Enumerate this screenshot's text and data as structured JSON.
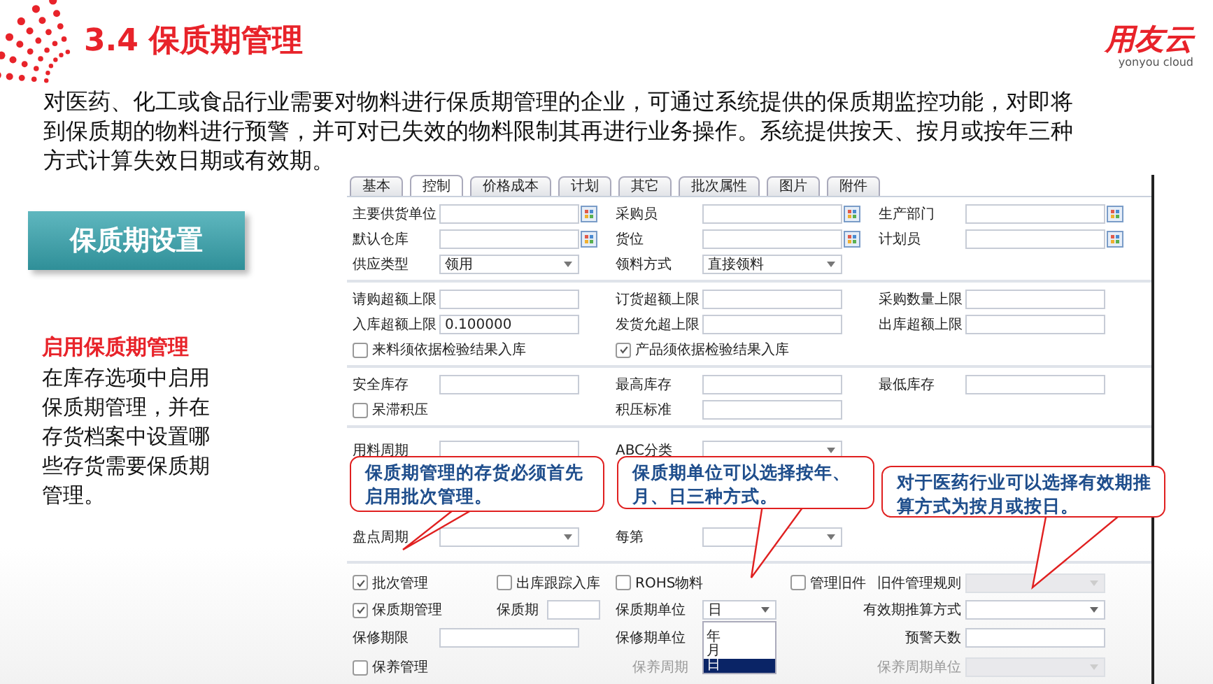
{
  "slide": {
    "title": "3.4 保质期管理",
    "logo": {
      "name": "用友云",
      "tagline": "yonyou cloud"
    },
    "intro": "对医药、化工或食品行业需要对物料进行保质期管理的企业，可通过系统提供的保质期监控功能，对即将到保质期的物料进行预警，并可对已失效的物料限制其再进行业务操作。系统提供按天、按月或按年三种方式计算失效日期或有效期。",
    "setting_button": "保质期设置",
    "note": {
      "heading": "启用保质期管理",
      "body": "在库存选项中启用保质期管理，并在存货档案中设置哪些存货需要保质期管理。"
    }
  },
  "form": {
    "tabs": [
      {
        "label": "基本",
        "selected": false
      },
      {
        "label": "控制",
        "selected": true
      },
      {
        "label": "价格成本",
        "selected": false
      },
      {
        "label": "计划",
        "selected": false
      },
      {
        "label": "其它",
        "selected": false
      },
      {
        "label": "批次属性",
        "selected": false
      },
      {
        "label": "图片",
        "selected": false
      },
      {
        "label": "附件",
        "selected": false
      }
    ],
    "sections": [
      {
        "rows": [
          [
            {
              "kind": "lookup",
              "label": "主要供货单位"
            },
            {
              "kind": "lookup",
              "label": "采购员"
            },
            {
              "kind": "lookup",
              "label": "生产部门"
            }
          ],
          [
            {
              "kind": "lookup",
              "label": "默认仓库"
            },
            {
              "kind": "lookup",
              "label": "货位"
            },
            {
              "kind": "lookup",
              "label": "计划员"
            }
          ],
          [
            {
              "kind": "select",
              "label": "供应类型",
              "value": "领用"
            },
            {
              "kind": "select",
              "label": "领料方式",
              "value": "直接领料"
            }
          ]
        ]
      },
      {
        "rows": [
          [
            {
              "kind": "field",
              "label": "请购超额上限"
            },
            {
              "kind": "field",
              "label": "订货超额上限"
            },
            {
              "kind": "field",
              "label": "采购数量上限"
            }
          ],
          [
            {
              "kind": "field",
              "label": "入库超额上限",
              "value": "0.100000"
            },
            {
              "kind": "field",
              "label": "发货允超上限"
            },
            {
              "kind": "field",
              "label": "出库超额上限"
            }
          ],
          [
            {
              "kind": "checkbox",
              "label": "来料须依据检验结果入库",
              "checked": false
            },
            {
              "kind": "checkbox",
              "label": "产品须依据检验结果入库",
              "checked": true
            }
          ]
        ]
      },
      {
        "rows": [
          [
            {
              "kind": "field",
              "label": "安全库存"
            },
            {
              "kind": "field",
              "label": "最高库存"
            },
            {
              "kind": "field",
              "label": "最低库存"
            }
          ],
          [
            {
              "kind": "checkbox",
              "label": "呆滞积压",
              "checked": false
            },
            {
              "kind": "field",
              "label": "积压标准"
            }
          ]
        ]
      },
      {
        "rows": [
          [
            {
              "kind": "field",
              "label": "用料周期"
            },
            {
              "kind": "select",
              "label": "ABC分类"
            }
          ],
          [
            {
              "kind": "select",
              "label": "盘点周期"
            },
            {
              "kind": "select",
              "label": "每第"
            }
          ]
        ]
      }
    ],
    "flags": {
      "batch": {
        "label": "批次管理",
        "checked": true
      },
      "outbound_tracking": {
        "label": "出库跟踪入库",
        "checked": false
      },
      "rohs": {
        "label": "ROHS物料",
        "checked": false
      },
      "old_parts": {
        "label": "管理旧件",
        "checked": false
      },
      "old_parts_rule": {
        "label": "旧件管理规则",
        "disabled": true
      },
      "shelf_life_management": {
        "label": "保质期管理",
        "checked": true
      },
      "shelf_life": {
        "label": "保质期"
      },
      "shelf_life_unit": {
        "label": "保质期单位",
        "value": "日",
        "options": [
          {
            "label": "年",
            "selected": false
          },
          {
            "label": "月",
            "selected": false
          },
          {
            "label": "日",
            "selected": true
          }
        ]
      },
      "expiry_calc": {
        "label": "有效期推算方式",
        "disabled": false
      },
      "warranty_period": {
        "label": "保修期限"
      },
      "warranty_unit": {
        "label": "保修期单位"
      },
      "warning_days": {
        "label": "预警天数"
      },
      "maintenance": {
        "label": "保养管理",
        "checked": false
      },
      "maintenance_cycle": {
        "label": "保养周期"
      },
      "maintenance_cycle_unit": {
        "label": "保养周期单位",
        "disabled": true
      }
    }
  },
  "callouts": [
    {
      "text": "保质期管理的存货必须首先启用批次管理。"
    },
    {
      "text": "保质期单位可以选择按年、月、日三种方式。"
    },
    {
      "text": "对于医药行业可以选择有效期推算方式为按月或按日。"
    }
  ]
}
